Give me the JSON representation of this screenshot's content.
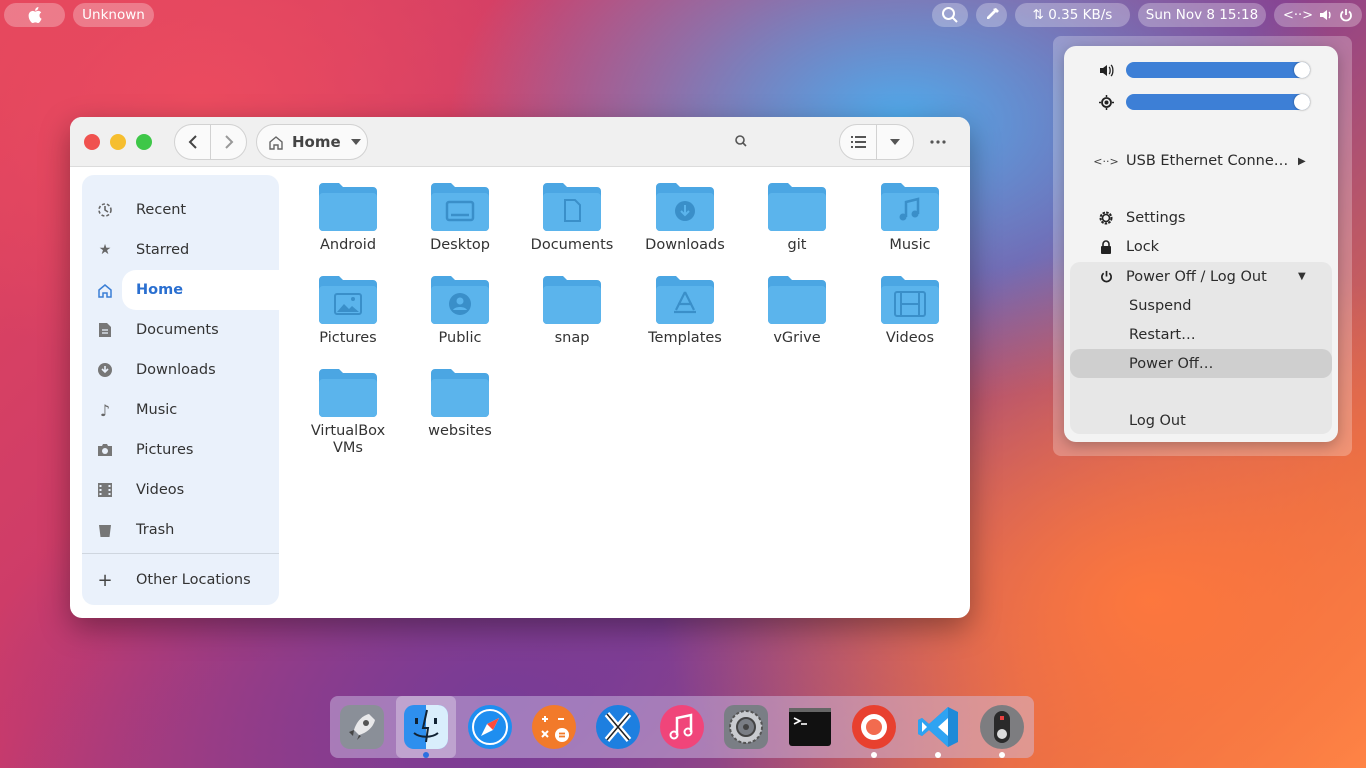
{
  "topbar": {
    "app_menu": "Unknown",
    "network_speed": "⇅ 0.35 KB/s",
    "clock": "Sun Nov 8  15:18"
  },
  "window": {
    "location": "Home",
    "sidebar": [
      {
        "label": "Recent",
        "icon": "clock-icon"
      },
      {
        "label": "Starred",
        "icon": "star-icon"
      },
      {
        "label": "Home",
        "icon": "home-icon"
      },
      {
        "label": "Documents",
        "icon": "document-icon"
      },
      {
        "label": "Downloads",
        "icon": "download-icon"
      },
      {
        "label": "Music",
        "icon": "music-icon"
      },
      {
        "label": "Pictures",
        "icon": "camera-icon"
      },
      {
        "label": "Videos",
        "icon": "film-icon"
      },
      {
        "label": "Trash",
        "icon": "trash-icon"
      },
      {
        "label": "Other Locations",
        "icon": "plus-icon"
      }
    ],
    "folders": [
      {
        "name": "Android",
        "emblem": "none"
      },
      {
        "name": "Desktop",
        "emblem": "desktop"
      },
      {
        "name": "Documents",
        "emblem": "document"
      },
      {
        "name": "Downloads",
        "emblem": "download"
      },
      {
        "name": "git",
        "emblem": "none"
      },
      {
        "name": "Music",
        "emblem": "music"
      },
      {
        "name": "Pictures",
        "emblem": "picture"
      },
      {
        "name": "Public",
        "emblem": "user"
      },
      {
        "name": "snap",
        "emblem": "none"
      },
      {
        "name": "Templates",
        "emblem": "template"
      },
      {
        "name": "vGrive",
        "emblem": "none"
      },
      {
        "name": "Videos",
        "emblem": "video"
      },
      {
        "name": "VirtualBox VMs",
        "emblem": "none"
      },
      {
        "name": "websites",
        "emblem": "none"
      }
    ]
  },
  "system_menu": {
    "volume_level": 1.0,
    "brightness_level": 1.0,
    "network": "USB Ethernet Conne…",
    "settings": "Settings",
    "lock": "Lock",
    "power_group": "Power Off / Log Out",
    "suspend": "Suspend",
    "restart": "Restart…",
    "power_off": "Power Off…",
    "log_out": "Log Out"
  },
  "colors": {
    "accent": "#3d7fd6",
    "folder": "#5bb4ec",
    "close": "#f0524f",
    "minimize": "#f6be2f",
    "maximize": "#3ec748"
  },
  "dock": [
    {
      "name": "launchpad",
      "running": false
    },
    {
      "name": "files",
      "running": true
    },
    {
      "name": "browser",
      "running": false
    },
    {
      "name": "calculator",
      "running": false
    },
    {
      "name": "x-app",
      "running": false
    },
    {
      "name": "music",
      "running": false
    },
    {
      "name": "system-settings",
      "running": false
    },
    {
      "name": "terminal",
      "running": false
    },
    {
      "name": "screen-recorder",
      "running": true
    },
    {
      "name": "vscode",
      "running": true
    },
    {
      "name": "switch",
      "running": true
    }
  ]
}
